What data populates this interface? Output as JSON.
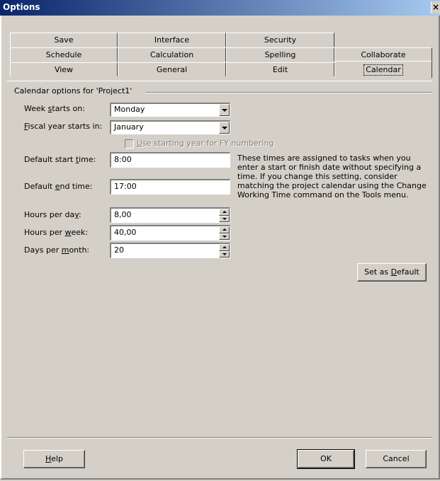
{
  "window": {
    "title": "Options",
    "close_glyph": "×"
  },
  "tabs": {
    "row1": [
      "Save",
      "Interface",
      "Security"
    ],
    "row2": [
      "Schedule",
      "Calculation",
      "Spelling",
      "Collaborate"
    ],
    "row3": [
      "View",
      "General",
      "Edit",
      "Calendar"
    ],
    "active": "Calendar"
  },
  "calendar": {
    "group_label": "Calendar options for 'Project1'",
    "week_starts_label_pre": "Week ",
    "week_starts_label_u": "s",
    "week_starts_label_post": "tarts on:",
    "week_starts_value": "Monday",
    "fiscal_label_u": "F",
    "fiscal_label_post": "iscal year starts in:",
    "fiscal_value": "January",
    "fy_numbering_label_u": "U",
    "fy_numbering_label_post": "se starting year for FY numbering",
    "start_time_label_pre": "Default start ",
    "start_time_label_u": "t",
    "start_time_label_post": "ime:",
    "start_time_value": "8:00",
    "end_time_label_pre": "Default ",
    "end_time_label_u": "e",
    "end_time_label_post": "nd time:",
    "end_time_value": "17:00",
    "info_text": "These times are assigned to tasks when you enter a start or finish date without specifying a time. If you change this setting, consider matching the project calendar using the Change Working Time command on the Tools menu.",
    "hours_day_label_pre": "Hours per da",
    "hours_day_label_u": "y",
    "hours_day_label_post": ":",
    "hours_day_value": "8,00",
    "hours_week_label_pre": "Hours per ",
    "hours_week_label_u": "w",
    "hours_week_label_post": "eek:",
    "hours_week_value": "40,00",
    "days_month_label_pre": "Days per ",
    "days_month_label_u": "m",
    "days_month_label_post": "onth:",
    "days_month_value": "20",
    "set_default_pre": "Set as ",
    "set_default_u": "D",
    "set_default_post": "efault"
  },
  "footer": {
    "help_u": "H",
    "help_post": "elp",
    "ok": "OK",
    "cancel": "Cancel"
  }
}
